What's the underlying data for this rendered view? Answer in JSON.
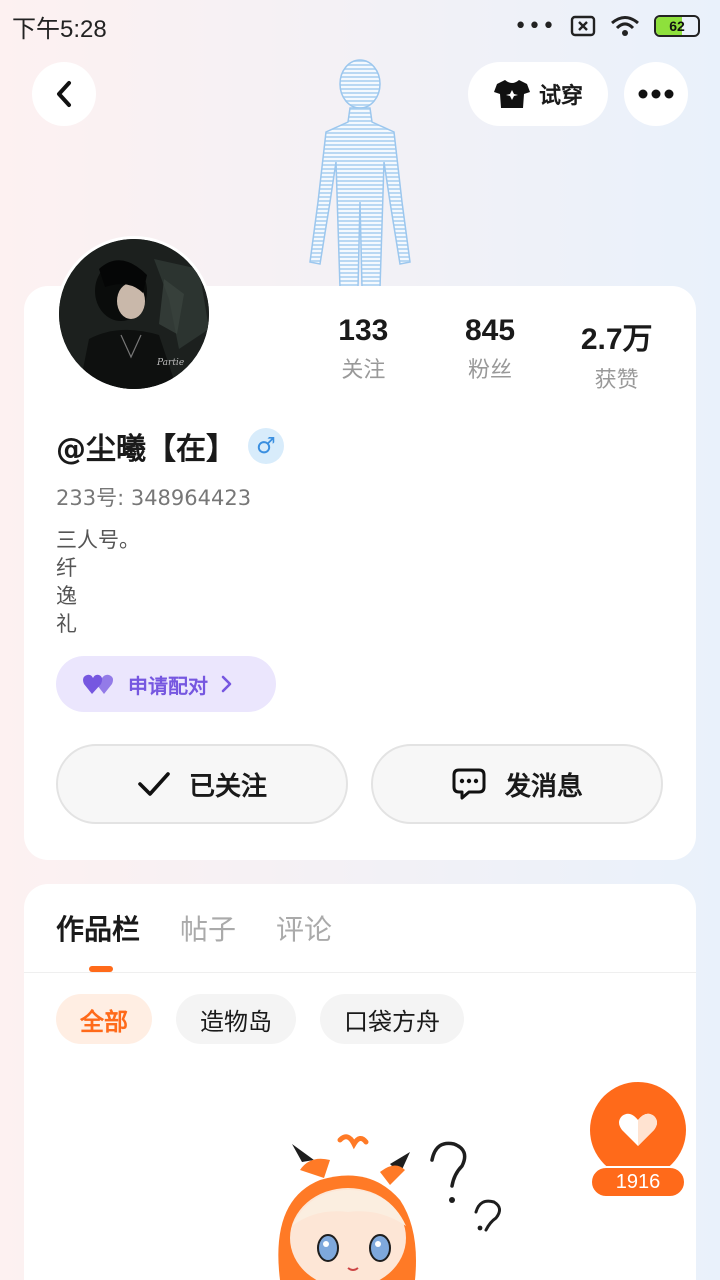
{
  "status_bar": {
    "time": "下午5:28",
    "battery": "62",
    "battery_level": 0.62
  },
  "header": {
    "tryon_label": "试穿"
  },
  "profile": {
    "stats": [
      {
        "value": "133",
        "label": "关注"
      },
      {
        "value": "845",
        "label": "粉丝"
      },
      {
        "value": "2.7万",
        "label": "获赞"
      }
    ],
    "username": "@尘曦【在】",
    "gender_symbol": "♂",
    "uid": "233号: 348964423",
    "bio": [
      "三人号。",
      "纤",
      "逸",
      "礼"
    ],
    "pair_label": "申请配对",
    "follow_label": "已关注",
    "message_label": "发消息"
  },
  "works": {
    "tabs": [
      "作品栏",
      "帖子",
      "评论"
    ],
    "filters": [
      "全部",
      "造物岛",
      "口袋方舟"
    ]
  },
  "like": {
    "count": "1916"
  },
  "colors": {
    "accent": "#ff6a1a",
    "pair_purple": "#7657e0",
    "gender_blue": "#3a8fe0"
  }
}
